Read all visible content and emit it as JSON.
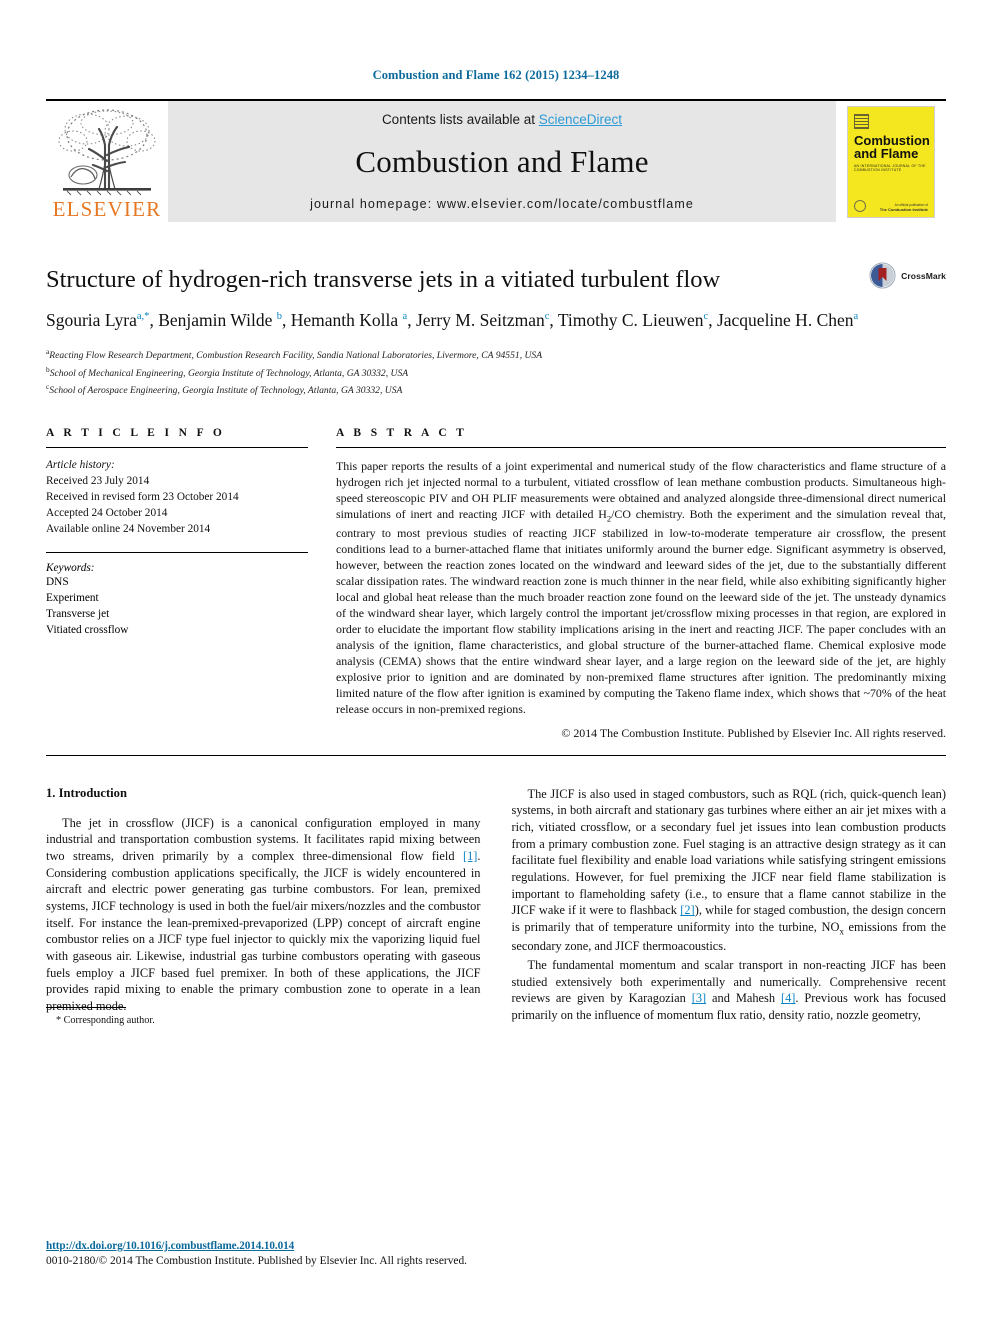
{
  "running_head": "Combustion and Flame 162 (2015) 1234–1248",
  "masthead": {
    "elsevier_logo_label": "ELSEVIER",
    "contents_prefix": "Contents lists available at ",
    "sciencedirect": "ScienceDirect",
    "journal_title": "Combustion and Flame",
    "homepage": "journal homepage: www.elsevier.com/locate/combustflame",
    "cover": {
      "title_line1": "Combustion",
      "title_line2": "and Flame",
      "subtitle": "AN INTERNATIONAL JOURNAL OF THE COMBUSTION INSTITUTE",
      "bottom_note": "An official publication of",
      "bottom_brand": "The Combustion Institute"
    }
  },
  "article": {
    "title": "Structure of hydrogen-rich transverse jets in a vitiated turbulent flow",
    "crossmark_label": "CrossMark",
    "authors": [
      {
        "name": "Sgouria Lyra",
        "marks": "a,*"
      },
      {
        "name": "Benjamin Wilde",
        "marks": "b"
      },
      {
        "name": "Hemanth Kolla",
        "marks": "a"
      },
      {
        "name": "Jerry M. Seitzman",
        "marks": "c"
      },
      {
        "name": "Timothy C. Lieuwen",
        "marks": "c"
      },
      {
        "name": "Jacqueline H. Chen",
        "marks": "a"
      }
    ],
    "affiliations": [
      {
        "mark": "a",
        "text": "Reacting Flow Research Department, Combustion Research Facility, Sandia National Laboratories, Livermore, CA 94551, USA"
      },
      {
        "mark": "b",
        "text": "School of Mechanical Engineering, Georgia Institute of Technology, Atlanta, GA 30332, USA"
      },
      {
        "mark": "c",
        "text": "School of Aerospace Engineering, Georgia Institute of Technology, Atlanta, GA 30332, USA"
      }
    ]
  },
  "article_info": {
    "heading": "A R T I C L E  I N F O",
    "history_label": "Article history:",
    "history": [
      "Received 23 July 2014",
      "Received in revised form 23 October 2014",
      "Accepted 24 October 2014",
      "Available online 24 November 2014"
    ],
    "keywords_label": "Keywords:",
    "keywords": [
      "DNS",
      "Experiment",
      "Transverse jet",
      "Vitiated crossflow"
    ]
  },
  "abstract": {
    "heading": "A B S T R A C T",
    "part1": "This paper reports the results of a joint experimental and numerical study of the flow characteristics and flame structure of a hydrogen rich jet injected normal to a turbulent, vitiated crossflow of lean methane combustion products. Simultaneous high-speed stereoscopic PIV and OH PLIF measurements were obtained and analyzed alongside three-dimensional direct numerical simulations of inert and reacting JICF with detailed H",
    "sub1": "2",
    "part2": "/CO chemistry. Both the experiment and the simulation reveal that, contrary to most previous studies of reacting JICF stabilized in low-to-moderate temperature air crossflow, the present conditions lead to a burner-attached flame that initiates uniformly around the burner edge. Significant asymmetry is observed, however, between the reaction zones located on the windward and leeward sides of the jet, due to the substantially different scalar dissipation rates. The windward reaction zone is much thinner in the near field, while also exhibiting significantly higher local and global heat release than the much broader reaction zone found on the leeward side of the jet. The unsteady dynamics of the windward shear layer, which largely control the important jet/crossflow mixing processes in that region, are explored in order to elucidate the important flow stability implications arising in the inert and reacting JICF. The paper concludes with an analysis of the ignition, flame characteristics, and global structure of the burner-attached flame. Chemical explosive mode analysis (CEMA) shows that the entire windward shear layer, and a large region on the leeward side of the jet, are highly explosive prior to ignition and are dominated by non-premixed flame structures after ignition. The predominantly mixing limited nature of the flow after ignition is examined by computing the Takeno flame index, which shows that ~70% of the heat release occurs in non-premixed regions.",
    "copyright": "© 2014 The Combustion Institute. Published by Elsevier Inc. All rights reserved."
  },
  "body": {
    "section_title": "1. Introduction",
    "left_p1_a": "The jet in crossflow (JICF) is a canonical configuration employed in many industrial and transportation combustion systems. It facilitates rapid mixing between two streams, driven primarily by a complex three-dimensional flow field ",
    "left_p1_cite": "[1]",
    "left_p1_b": ". Considering combustion applications specifically, the JICF is widely encountered in aircraft and electric power generating gas turbine combustors. For lean, premixed systems, JICF technology is used in both the fuel/air mixers/nozzles and the combustor itself. For instance the lean-premixed-prevaporized (LPP) concept of aircraft engine combustor relies on a JICF type fuel injector to quickly mix the vaporizing liquid fuel with gaseous air. Likewise, industrial gas turbine combustors operating with gaseous fuels employ a JICF based fuel premixer. In both of these applications, the JICF provides rapid mixing to enable the primary combustion zone to operate in a lean premixed mode.",
    "footnote": "* Corresponding author.",
    "right_p1_a": "The JICF is also used in staged combustors, such as RQL (rich, quick-quench lean) systems, in both aircraft and stationary gas turbines where either an air jet mixes with a rich, vitiated crossflow, or a secondary fuel jet issues into lean combustion products from a primary combustion zone. Fuel staging is an attractive design strategy as it can facilitate fuel flexibility and enable load variations while satisfying stringent emissions regulations. However, for fuel premixing the JICF near field flame stabilization is important to flameholding safety (i.e., to ensure that a flame cannot stabilize in the JICF wake if it were to flashback ",
    "right_p1_cite": "[2]",
    "right_p1_b": "), while for staged combustion, the design concern is primarily that of temperature uniformity into the turbine, NO",
    "right_p1_sub": "x",
    "right_p1_c": " emissions from the secondary zone, and JICF thermoacoustics.",
    "right_p2_a": "The fundamental momentum and scalar transport in non-reacting JICF has been studied extensively both experimentally and numerically. Comprehensive recent reviews are given by Karagozian ",
    "right_p2_cite1": "[3]",
    "right_p2_b": " and Mahesh ",
    "right_p2_cite2": "[4]",
    "right_p2_c": ". Previous work has focused primarily on the influence of momentum flux ratio, density ratio, nozzle geometry,"
  },
  "footer": {
    "doi": "http://dx.doi.org/10.1016/j.combustflame.2014.10.014",
    "issn_line": "0010-2180/© 2014 The Combustion Institute. Published by Elsevier Inc. All rights reserved."
  },
  "colors": {
    "link_blue": "#0b84c4",
    "header_blue": "#0b6a9b",
    "elsevier_orange": "#E87722",
    "cover_yellow": "#f5e71f"
  }
}
